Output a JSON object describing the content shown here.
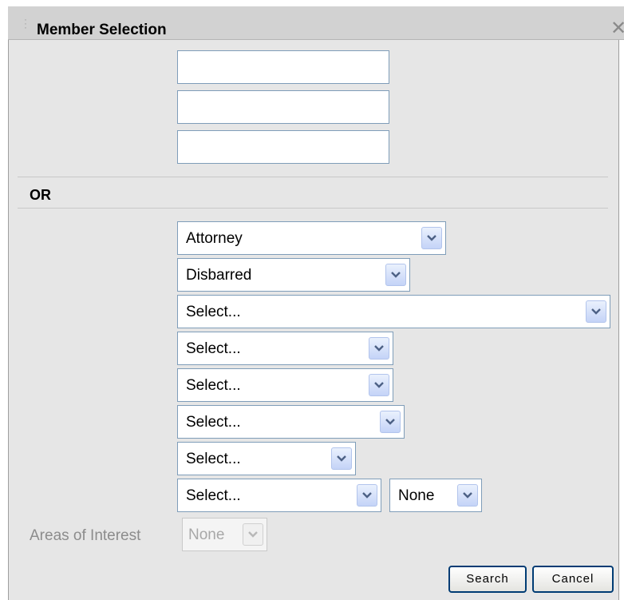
{
  "dialog": {
    "title": "Member Selection",
    "close_glyph": "✕"
  },
  "text_inputs": [
    "",
    "",
    ""
  ],
  "or_label": "OR",
  "selects": [
    {
      "value": "Attorney"
    },
    {
      "value": "Disbarred"
    },
    {
      "value": "Select..."
    },
    {
      "value": "Select..."
    },
    {
      "value": "Select..."
    },
    {
      "value": "Select..."
    },
    {
      "value": "Select..."
    },
    {
      "value": "Select..."
    },
    {
      "value": "None"
    }
  ],
  "areas_of_interest": {
    "label": "Areas of Interest",
    "value": "None",
    "disabled": true
  },
  "buttons": {
    "search": "Search",
    "cancel": "Cancel"
  },
  "colors": {
    "dialog_bg": "#e6e6e6",
    "titlebar_bg": "#d2d2d2",
    "input_border": "#7f9db9",
    "dropdown_arrow": "#4d6185",
    "button_border": "#003c74"
  },
  "icons": {
    "close": "close-icon",
    "grip": "drag-grip-icon",
    "dropdown": "chevron-down-icon"
  }
}
